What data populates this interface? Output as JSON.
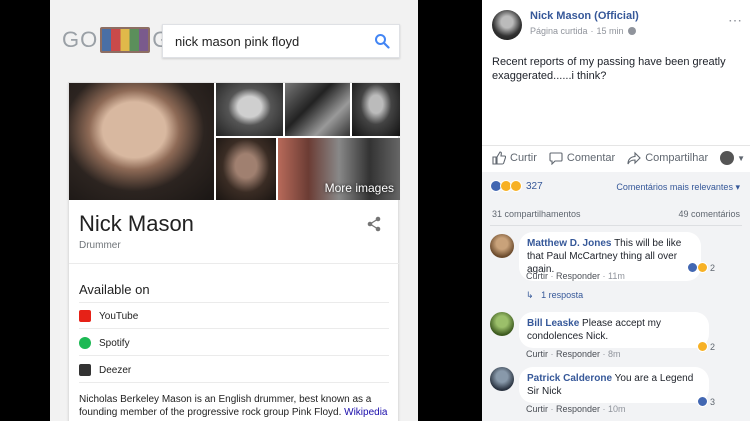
{
  "google": {
    "logo_left": "GO",
    "logo_right": "GLE",
    "search_query": "nick mason pink floyd",
    "more_images": "More images",
    "title": "Nick Mason",
    "subtitle": "Drummer",
    "available_on": "Available on",
    "services": [
      {
        "label": "YouTube",
        "color": "#e62117"
      },
      {
        "label": "Spotify",
        "color": "#1db954"
      },
      {
        "label": "Deezer",
        "color": "#333333"
      }
    ],
    "description": "Nicholas Berkeley Mason is an English drummer, best known as a founding member of the progressive rock group Pink Floyd.",
    "wikipedia": "Wikipedia"
  },
  "facebook": {
    "page_name": "Nick Mason (Official)",
    "page_type": "Página curtida",
    "time": "15 min",
    "post_text": "Recent reports of my passing have been greatly exaggerated......i think?",
    "actions": {
      "like": "Curtir",
      "comment": "Comentar",
      "share": "Compartilhar"
    },
    "reaction_count": "327",
    "sort_label": "Comentários mais relevantes",
    "shares": "31 compartilhamentos",
    "comments_count": "49 comentários",
    "comments": [
      {
        "author": "Matthew D. Jones",
        "text": "This will be like that Paul McCartney thing all over again.",
        "like": "Curtir",
        "reply": "Responder",
        "time": "11m",
        "reactions": "2",
        "replies": "1 resposta"
      },
      {
        "author": "Bill Leaske",
        "text": "Please accept my condolences Nick.",
        "like": "Curtir",
        "reply": "Responder",
        "time": "8m",
        "reactions": "2"
      },
      {
        "author": "Patrick Calderone",
        "text": "You are a Legend Sir Nick",
        "like": "Curtir",
        "reply": "Responder",
        "time": "10m",
        "reactions": "3"
      }
    ],
    "colors": {
      "link": "#365899",
      "like_blue": "#4267b2",
      "haha_yellow": "#f7b125"
    }
  }
}
